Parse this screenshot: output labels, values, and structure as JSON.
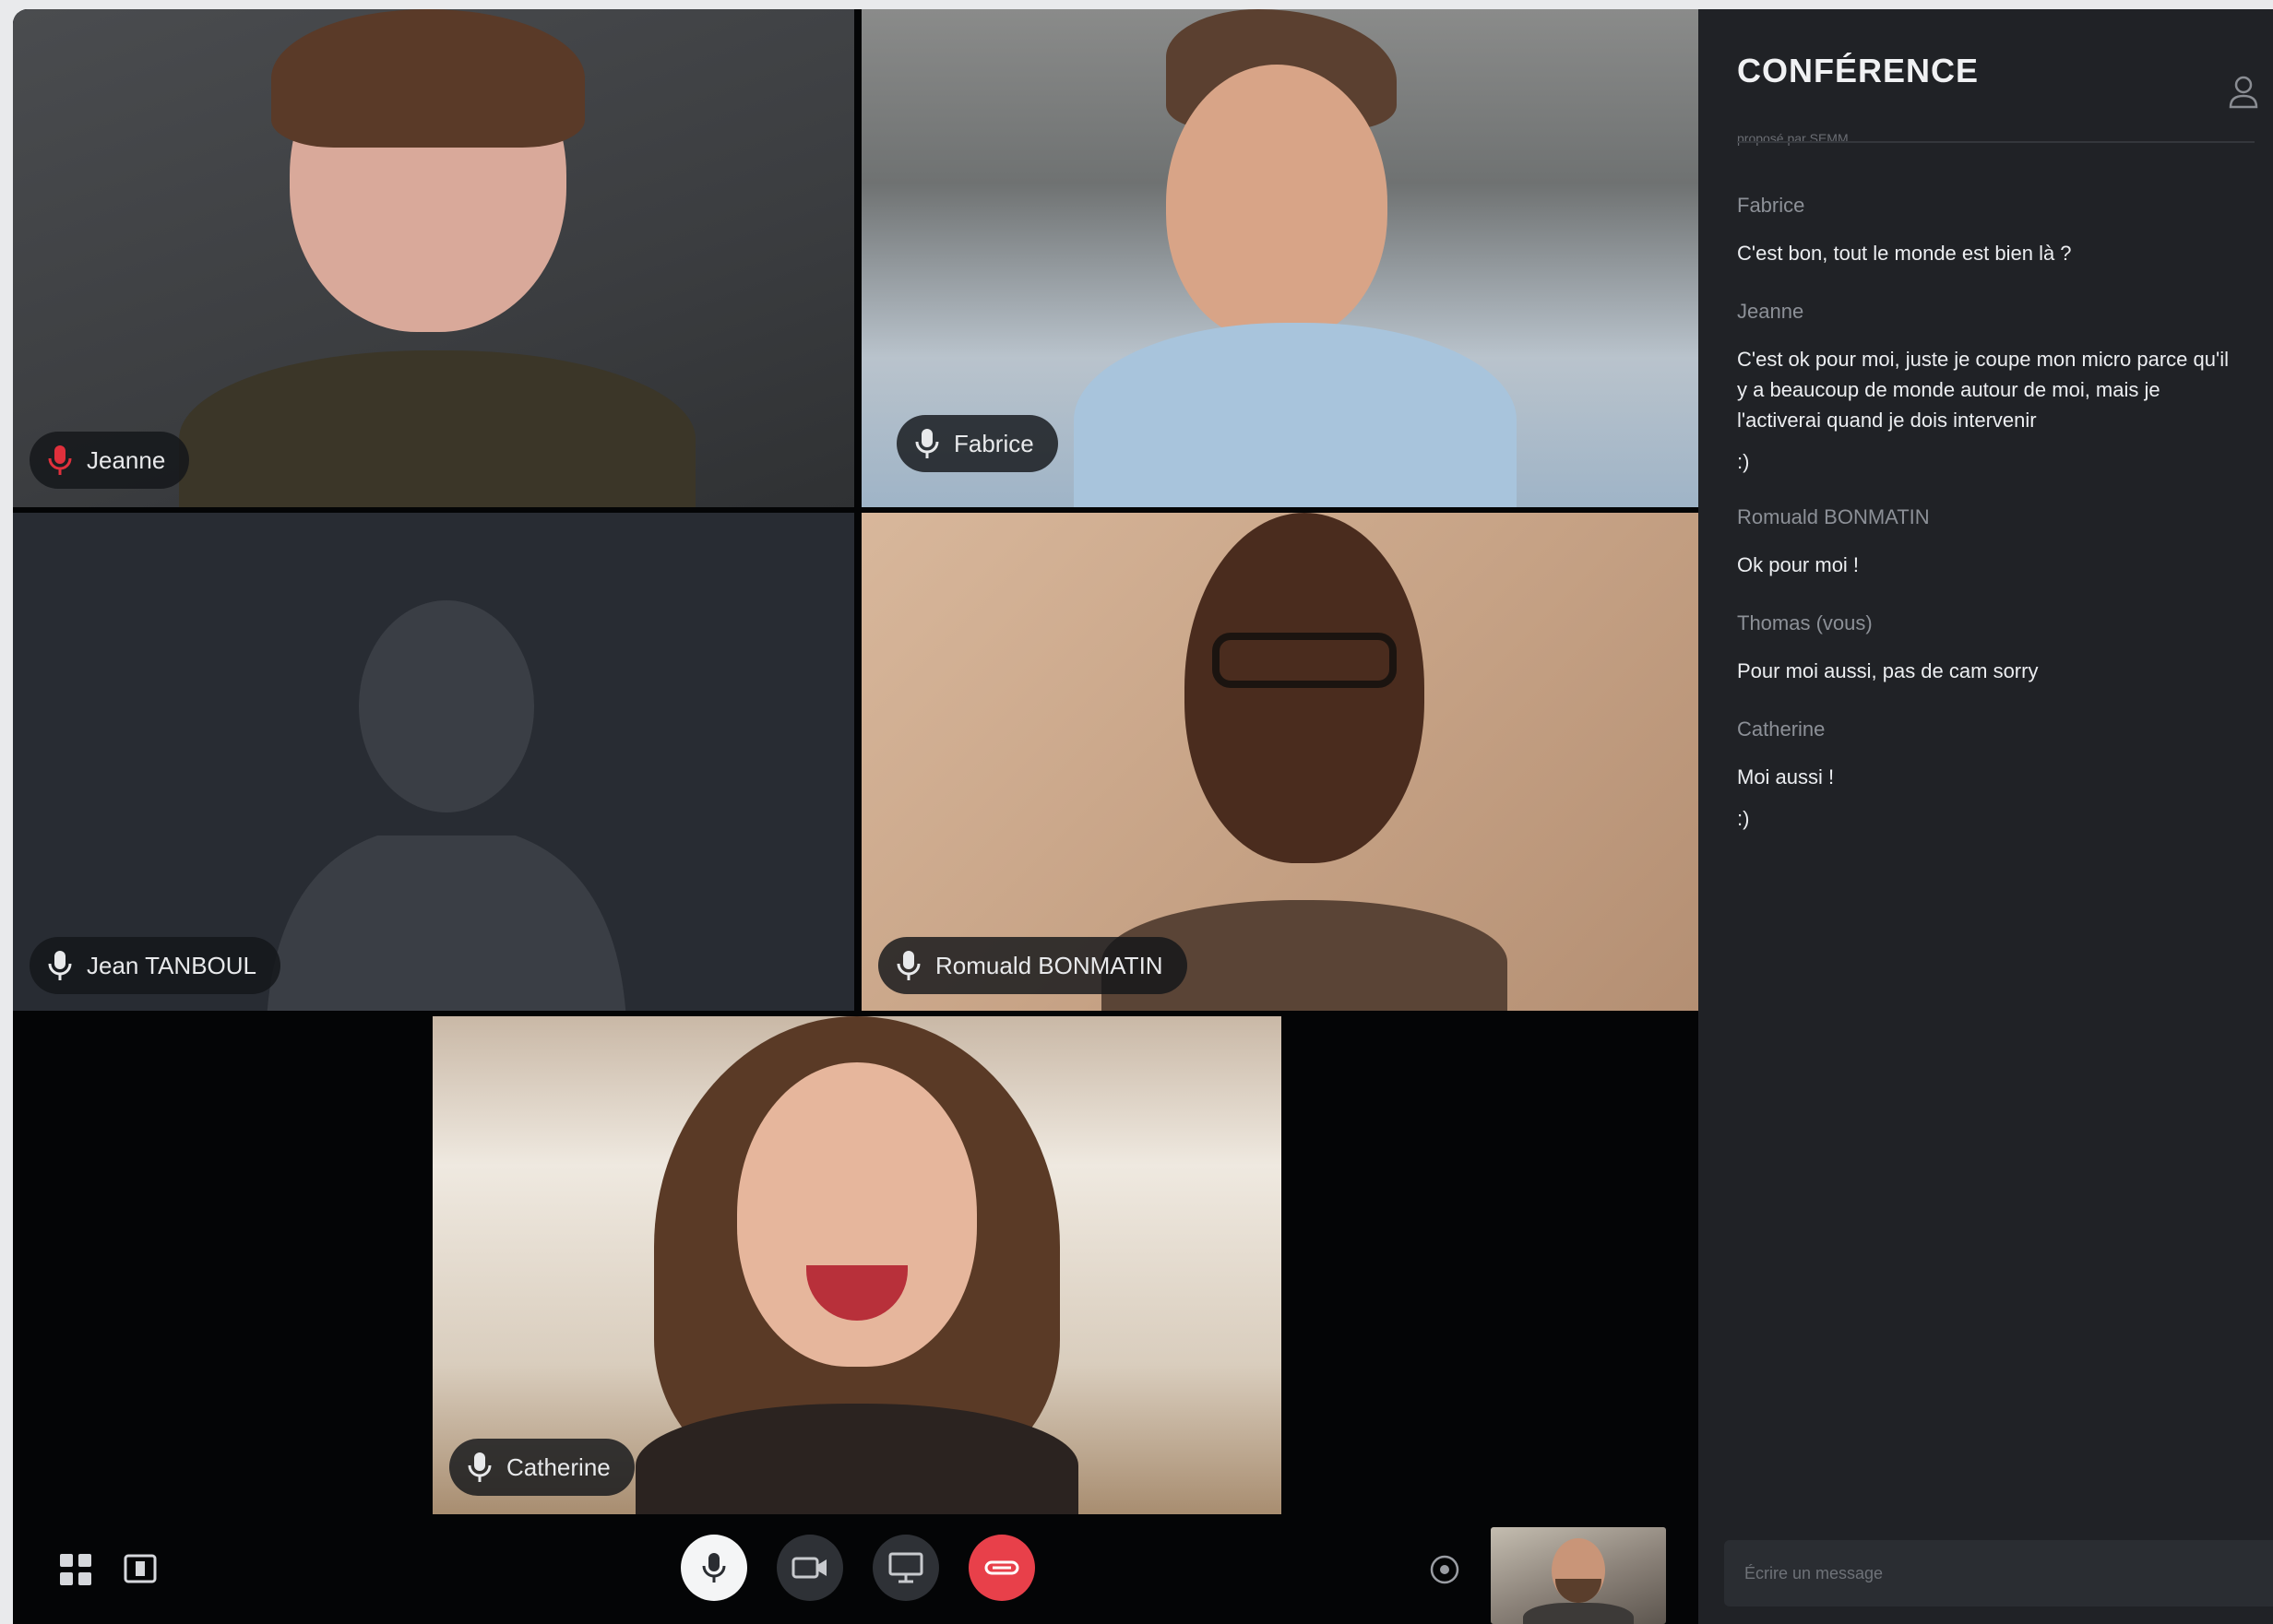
{
  "chat": {
    "title": "CONFÉRENCE",
    "subtitle": "proposé par SEMM",
    "input_placeholder": "Écrire un message",
    "messages": [
      {
        "author": "Fabrice",
        "text": "C'est bon, tout le monde est bien là ?",
        "emoji": ""
      },
      {
        "author": "Jeanne",
        "text": "C'est ok pour moi, juste je coupe mon micro parce qu'il y a beaucoup de monde autour de moi, mais je l'activerai quand je dois intervenir",
        "emoji": ":)"
      },
      {
        "author": "Romuald BONMATIN",
        "text": "Ok pour moi !",
        "emoji": ""
      },
      {
        "author": "Thomas (vous)",
        "text": "Pour moi aussi, pas de cam sorry",
        "emoji": ""
      },
      {
        "author": "Catherine",
        "text": "Moi aussi !",
        "emoji": ":)"
      }
    ]
  },
  "participants": {
    "jeanne": {
      "name": "Jeanne",
      "mic": "muted"
    },
    "fabrice": {
      "name": "Fabrice",
      "mic": "on"
    },
    "jean": {
      "name": "Jean TANBOUL",
      "mic": "on",
      "camera": "off"
    },
    "romuald": {
      "name": "Romuald BONMATIN",
      "mic": "on"
    },
    "catherine": {
      "name": "Catherine",
      "mic": "on"
    }
  },
  "colors": {
    "muted_mic": "#e0303c",
    "hangup": "#e8404a",
    "panel": "#202226",
    "stage": "#040506"
  }
}
